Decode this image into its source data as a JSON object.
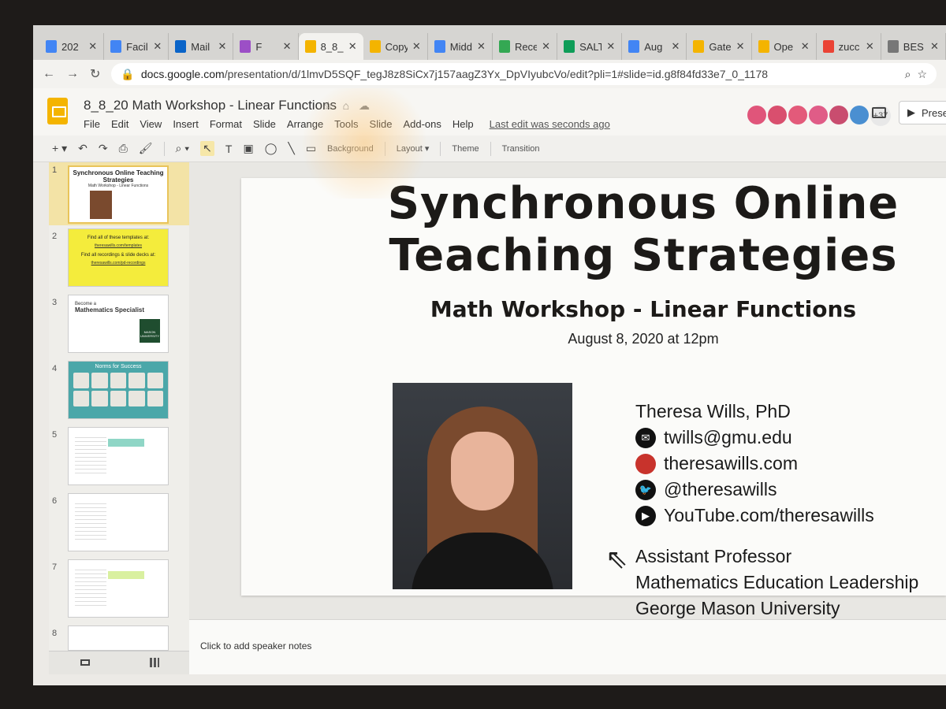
{
  "browser": {
    "tabs": [
      {
        "label": "202",
        "color": "#4285f4"
      },
      {
        "label": "Facil",
        "color": "#4285f4"
      },
      {
        "label": "Mail",
        "color": "#0a64c8"
      },
      {
        "label": "F",
        "color": "#9c4fc6"
      },
      {
        "label": "8_8_",
        "color": "#f4b400",
        "active": true
      },
      {
        "label": "Copy",
        "color": "#f4b400"
      },
      {
        "label": "Midd",
        "color": "#4285f4"
      },
      {
        "label": "Rece",
        "color": "#34a853"
      },
      {
        "label": "SALT",
        "color": "#0f9d58"
      },
      {
        "label": "Aug",
        "color": "#4285f4"
      },
      {
        "label": "Gate",
        "color": "#f4b400"
      },
      {
        "label": "Ope",
        "color": "#f4b400"
      },
      {
        "label": "zucc",
        "color": "#ea4335"
      },
      {
        "label": "BES",
        "color": "#777777"
      }
    ],
    "url_host": "docs.google.com",
    "url_path": "/presentation/d/1lmvD5SQF_tegJ8z8SiCx7j157aagZ3Yx_DpVIyubcVo/edit?pli=1#slide=id.g8f84fd33e7_0_1178"
  },
  "docs": {
    "title": "8_8_20 Math Workshop - Linear Functions",
    "menu": [
      "File",
      "Edit",
      "View",
      "Insert",
      "Format",
      "Slide",
      "Arrange",
      "Tools",
      "Slide",
      "Add-ons",
      "Help"
    ],
    "last_edit": "Last edit was seconds ago",
    "collaborators_more": "+37",
    "present_label": "Prese",
    "avatar_colors": [
      "#e0557a",
      "#d94f6e",
      "#e35a7a",
      "#e05c87",
      "#c94d6f",
      "#4a8fd1"
    ]
  },
  "edit_toolbar": {
    "background": "Background",
    "layout": "Layout",
    "theme": "Theme",
    "transition": "Transition"
  },
  "filmstrip": {
    "numbers": [
      "1",
      "2",
      "3",
      "4",
      "5",
      "6",
      "7",
      "8"
    ],
    "t1_title": "Synchronous Online Teaching Strategies",
    "t1_sub": "Math Workshop - Linear Functions",
    "t2_line1": "Find all of these templates at:",
    "t2_link1": "theresawills.com/templates",
    "t2_line2": "Find all recordings & slide decks at:",
    "t2_link2": "theresawills.com/pd-recordings",
    "t3_h": "Become a",
    "t3_h2": "Mathematics Specialist",
    "t3_logo": "MASON UNIVERSITY",
    "t4_h": "Norms for Success"
  },
  "slide": {
    "title": "Synchronous Online Teaching Strategies",
    "subtitle": "Math Workshop - Linear Functions",
    "date": "August 8, 2020 at 12pm",
    "name": "Theresa Wills, PhD",
    "email": "twills@gmu.edu",
    "website": "theresawills.com",
    "twitter": "@theresawills",
    "youtube": "YouTube.com/theresawills",
    "role": "Assistant Professor",
    "dept": "Mathematics Education Leadership",
    "university": "George Mason University"
  },
  "notes": {
    "placeholder": "Click to add speaker notes"
  }
}
